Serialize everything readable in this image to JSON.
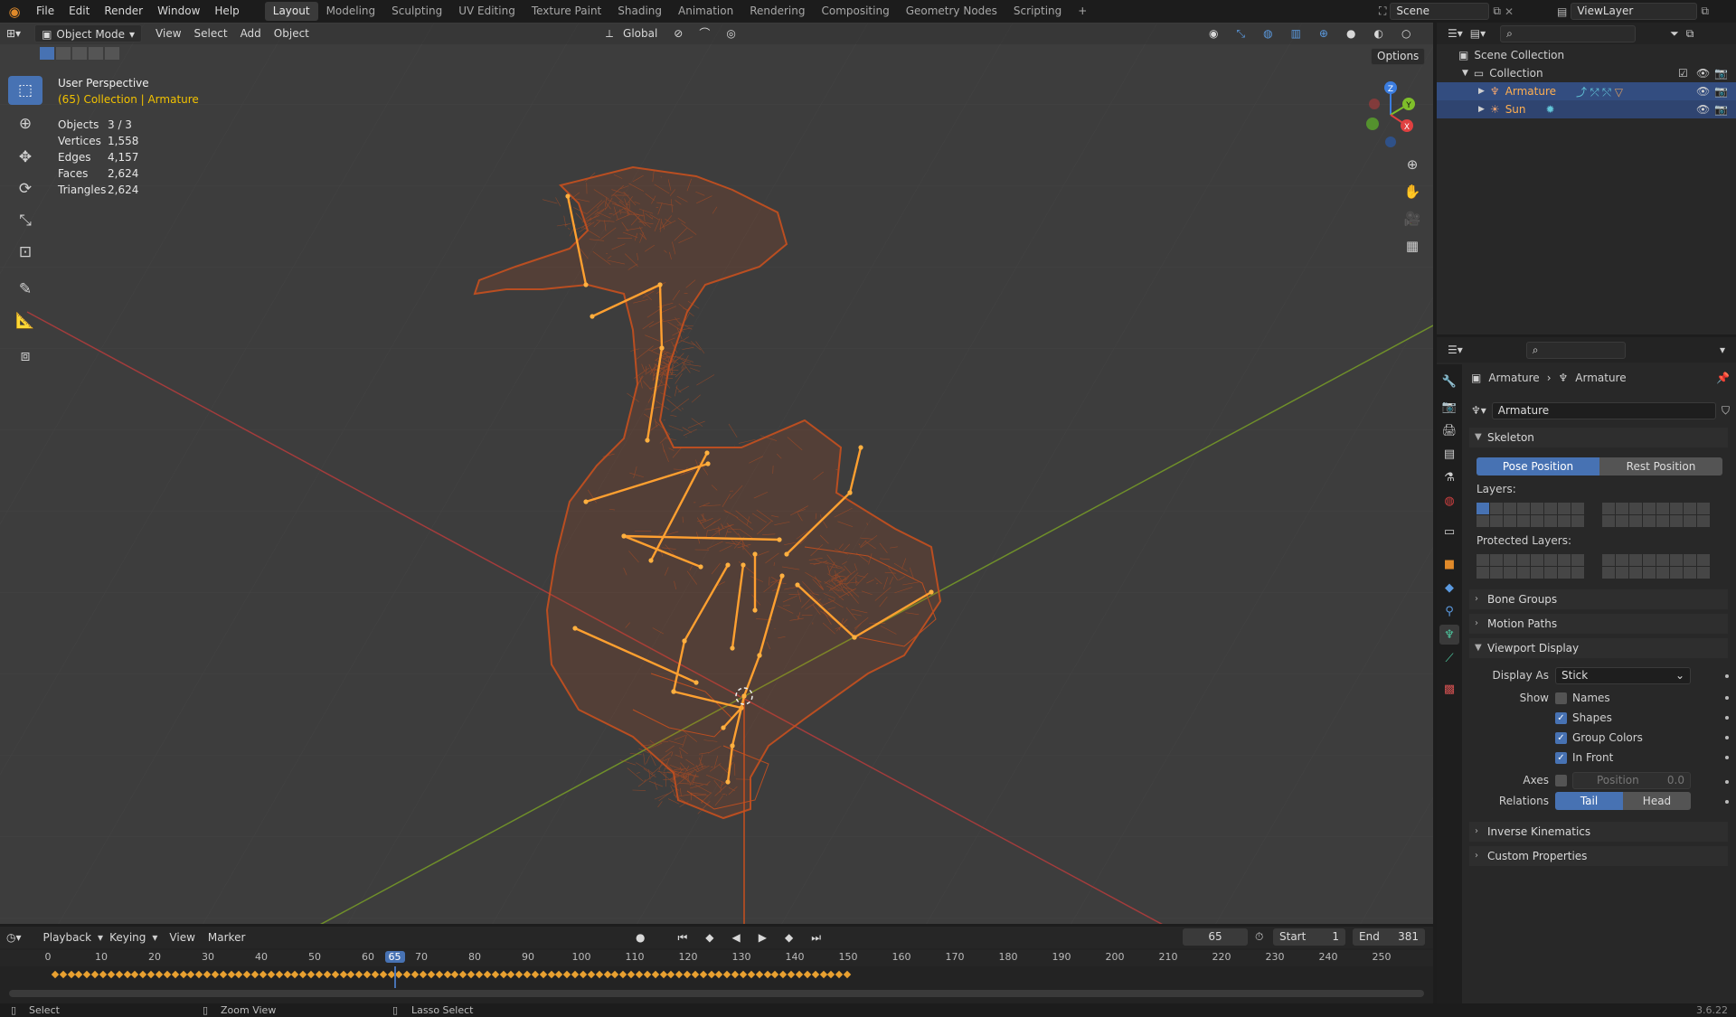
{
  "topbar": {
    "menus": [
      "File",
      "Edit",
      "Render",
      "Window",
      "Help"
    ],
    "workspaces": [
      "Layout",
      "Modeling",
      "Sculpting",
      "UV Editing",
      "Texture Paint",
      "Shading",
      "Animation",
      "Rendering",
      "Compositing",
      "Geometry Nodes",
      "Scripting"
    ],
    "active_workspace": "Layout",
    "add_tab": "+",
    "scene": "Scene",
    "view_layer": "ViewLayer"
  },
  "viewport": {
    "mode": "Object Mode",
    "menus": [
      "View",
      "Select",
      "Add",
      "Object"
    ],
    "orientation": "Global",
    "options_label": "Options",
    "perspective": "User Perspective",
    "context": "(65) Collection | Armature",
    "stats": [
      {
        "label": "Objects",
        "value": "3 / 3"
      },
      {
        "label": "Vertices",
        "value": "1,558"
      },
      {
        "label": "Edges",
        "value": "4,157"
      },
      {
        "label": "Faces",
        "value": "2,624"
      },
      {
        "label": "Triangles",
        "value": "2,624"
      }
    ],
    "gizmo": {
      "z": "Z",
      "y": "Y",
      "x": "X"
    },
    "tools": [
      "select-box-icon",
      "cursor-icon",
      "move-icon",
      "rotate-icon",
      "scale-icon",
      "transform-icon",
      "annotate-icon",
      "measure-icon",
      "add-cube-icon"
    ],
    "colors": {
      "wire": "#c8501e",
      "bone": "#ffa030",
      "bg": "#3d3d3d",
      "x_axis": "#a33c3c",
      "y_axis": "#6f8f2a"
    }
  },
  "outliner": {
    "root": "Scene Collection",
    "collection": "Collection",
    "items": [
      {
        "name": "Armature",
        "selected": true
      },
      {
        "name": "Sun",
        "selected": true
      }
    ]
  },
  "properties": {
    "breadcrumb": [
      "Armature",
      "Armature"
    ],
    "data_name": "Armature",
    "skeleton": {
      "title": "Skeleton",
      "pose_position": "Pose Position",
      "rest_position": "Rest Position",
      "layers_label": "Layers:",
      "protected_label": "Protected Layers:"
    },
    "collapsed_panels": [
      "Bone Groups",
      "Motion Paths"
    ],
    "viewport_display": {
      "title": "Viewport Display",
      "display_as_label": "Display As",
      "display_as_value": "Stick",
      "show_label": "Show",
      "show_options": [
        {
          "label": "Names",
          "checked": false
        },
        {
          "label": "Shapes",
          "checked": true
        },
        {
          "label": "Group Colors",
          "checked": true
        },
        {
          "label": "In Front",
          "checked": true
        }
      ],
      "axes_label": "Axes",
      "axes_position_label": "Position",
      "axes_position_value": "0.0",
      "relations_label": "Relations",
      "relations_tail": "Tail",
      "relations_head": "Head"
    },
    "bottom_panels": [
      "Inverse Kinematics",
      "Custom Properties"
    ]
  },
  "timeline": {
    "menus": [
      "Playback",
      "Keying",
      "View",
      "Marker"
    ],
    "current_frame": "65",
    "start_label": "Start",
    "start": "1",
    "end_label": "End",
    "end": "381",
    "ruler": [
      "0",
      "10",
      "20",
      "30",
      "40",
      "50",
      "60",
      "65",
      "70",
      "80",
      "90",
      "100",
      "110",
      "120",
      "130",
      "140",
      "150",
      "160",
      "170",
      "180",
      "190",
      "200",
      "210",
      "220",
      "230",
      "240",
      "250"
    ]
  },
  "statusbar": {
    "select": "Select",
    "zoom": "Zoom View",
    "lasso": "Lasso Select",
    "version": "3.6.22"
  }
}
